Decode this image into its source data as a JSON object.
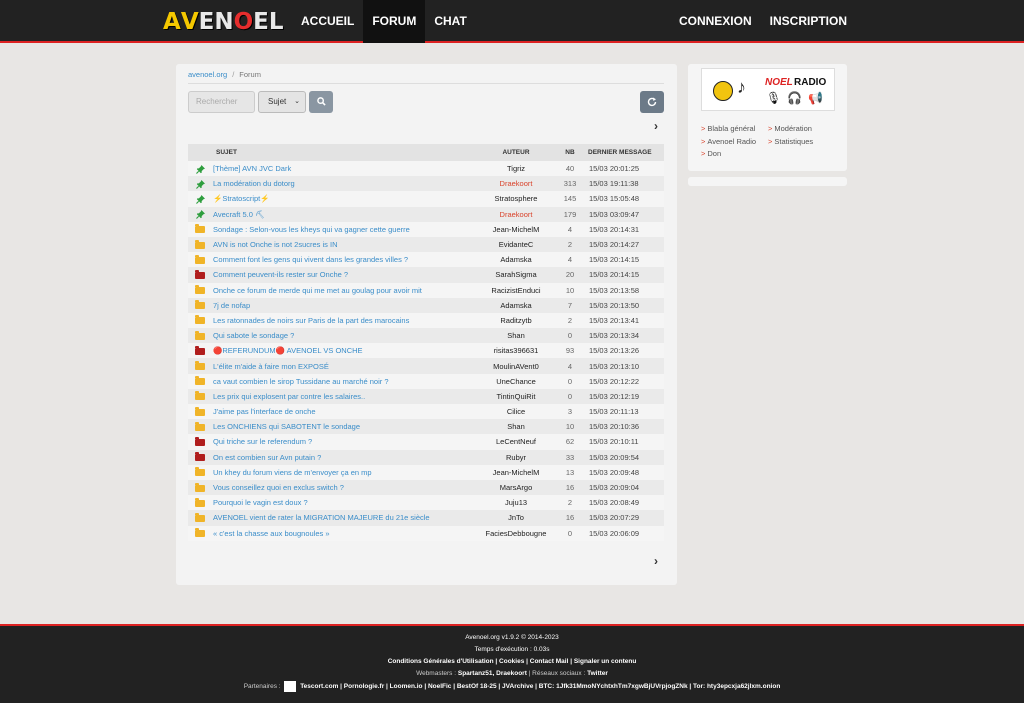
{
  "header": {
    "logo_letters": [
      "A",
      "V",
      "E",
      "N",
      "O",
      "E",
      "L"
    ],
    "logo_colors": [
      "#f5c800",
      "#f5c800",
      "#e8e8e8",
      "#e8e8e8",
      "#e52d2d",
      "#e8e8e8",
      "#e8e8e8"
    ],
    "nav_left": [
      "ACCUEIL",
      "FORUM",
      "CHAT"
    ],
    "nav_right": [
      "CONNEXION",
      "INSCRIPTION"
    ],
    "active": "FORUM"
  },
  "breadcrumb": {
    "home": "avenoel.org",
    "current": "Forum"
  },
  "search": {
    "placeholder": "Rechercher",
    "select_value": "Sujet"
  },
  "table": {
    "headers": {
      "subject": "SUJET",
      "author": "AUTEUR",
      "nb": "NB",
      "last": "DERNIER MESSAGE"
    },
    "rows": [
      {
        "icon": "pin",
        "title": "[Thème] AVN JVC Dark",
        "author": "Tigriz",
        "mod": false,
        "nb": "40",
        "date": "15/03 20:01:25"
      },
      {
        "icon": "pin",
        "title": "La modération du dotorg",
        "author": "Draekoort",
        "mod": true,
        "nb": "313",
        "date": "15/03 19:11:38"
      },
      {
        "icon": "pin",
        "title": "⚡Stratoscript⚡",
        "author": "Stratosphere",
        "mod": false,
        "nb": "145",
        "date": "15/03 15:05:48"
      },
      {
        "icon": "pin",
        "title": "Avecraft 5.0 ⛏",
        "author": "Draekoort",
        "mod": true,
        "nb": "179",
        "date": "15/03 03:09:47"
      },
      {
        "icon": "folder",
        "title": "Sondage : Selon-vous les kheys qui va gagner cette guerre",
        "author": "Jean-MichelM",
        "mod": false,
        "nb": "4",
        "date": "15/03 20:14:31"
      },
      {
        "icon": "folder",
        "title": "AVN is not Onche is not 2sucres is IN",
        "author": "EvidanteC",
        "mod": false,
        "nb": "2",
        "date": "15/03 20:14:27"
      },
      {
        "icon": "folder",
        "title": "Comment font les gens qui vivent dans les grandes villes ?",
        "author": "Adamska",
        "mod": false,
        "nb": "4",
        "date": "15/03 20:14:15"
      },
      {
        "icon": "hot",
        "title": "Comment peuvent-ils rester sur Onche ?",
        "author": "SarahSigma",
        "mod": false,
        "nb": "20",
        "date": "15/03 20:14:15"
      },
      {
        "icon": "folder",
        "title": "Onche ce forum de merde qui me met au goulag pour avoir mit",
        "author": "RacizistEnduci",
        "mod": false,
        "nb": "10",
        "date": "15/03 20:13:58"
      },
      {
        "icon": "folder",
        "title": "7j de nofap",
        "author": "Adamska",
        "mod": false,
        "nb": "7",
        "date": "15/03 20:13:50"
      },
      {
        "icon": "folder",
        "title": "Les ratonnades de noirs sur Paris de la part des marocains",
        "author": "Raditzytb",
        "mod": false,
        "nb": "2",
        "date": "15/03 20:13:41"
      },
      {
        "icon": "folder",
        "title": "Qui sabote le sondage ?",
        "author": "Shan",
        "mod": false,
        "nb": "0",
        "date": "15/03 20:13:34"
      },
      {
        "icon": "hot",
        "title": "🔴REFERUNDUM🔴 AVENOEL VS ONCHE",
        "author": "risitas396631",
        "mod": false,
        "nb": "93",
        "date": "15/03 20:13:26"
      },
      {
        "icon": "folder",
        "title": "L'élite m'aide à faire mon EXPOSÉ",
        "author": "MoulinAVent0",
        "mod": false,
        "nb": "4",
        "date": "15/03 20:13:10"
      },
      {
        "icon": "folder",
        "title": "ca vaut combien le sirop Tussidane au marché noir ?",
        "author": "UneChance",
        "mod": false,
        "nb": "0",
        "date": "15/03 20:12:22"
      },
      {
        "icon": "folder",
        "title": "Les prix qui explosent par contre les salaires..",
        "author": "TintinQuiRit",
        "mod": false,
        "nb": "0",
        "date": "15/03 20:12:19"
      },
      {
        "icon": "folder",
        "title": "J'aime pas l'interface de onche",
        "author": "Cilice",
        "mod": false,
        "nb": "3",
        "date": "15/03 20:11:13"
      },
      {
        "icon": "folder",
        "title": "Les ONCHIENS qui SABOTENT le sondage",
        "author": "Shan",
        "mod": false,
        "nb": "10",
        "date": "15/03 20:10:36"
      },
      {
        "icon": "hot",
        "title": "Qui triche sur le referendum ?",
        "author": "LeCentNeuf",
        "mod": false,
        "nb": "62",
        "date": "15/03 20:10:11"
      },
      {
        "icon": "hot",
        "title": "On est combien sur Avn putain ?",
        "author": "Rubyr",
        "mod": false,
        "nb": "33",
        "date": "15/03 20:09:54"
      },
      {
        "icon": "folder",
        "title": "Un khey du forum viens de m'envoyer ça en mp",
        "author": "Jean-MichelM",
        "mod": false,
        "nb": "13",
        "date": "15/03 20:09:48"
      },
      {
        "icon": "folder",
        "title": "Vous conseillez quoi en exclus switch ?",
        "author": "MarsArgo",
        "mod": false,
        "nb": "16",
        "date": "15/03 20:09:04"
      },
      {
        "icon": "folder",
        "title": "Pourquoi le vagin est doux ?",
        "author": "Juju13",
        "mod": false,
        "nb": "2",
        "date": "15/03 20:08:49"
      },
      {
        "icon": "folder",
        "title": "AVENOEL vient de rater la MIGRATION MAJEURE du 21e siècle",
        "author": "JnTo",
        "mod": false,
        "nb": "16",
        "date": "15/03 20:07:29"
      },
      {
        "icon": "folder",
        "title": "« c'est la chasse aux bougnoules »",
        "author": "FaciesDebbougne",
        "mod": false,
        "nb": "0",
        "date": "15/03 20:06:09"
      }
    ]
  },
  "sidebar": {
    "radio": {
      "noel": "NOEL",
      "radio": "RADIO"
    },
    "links_left": [
      "Blabla général",
      "Avenoel Radio",
      "Don"
    ],
    "links_right": [
      "Modération",
      "Statistiques"
    ]
  },
  "footer": {
    "version": "Avenoel.org v1.9.2 © 2014-2023",
    "exec": "Temps d'exécution : 0.03s",
    "legal": "Conditions Générales d'Utilisation | Cookies | Contact Mail | Signaler un contenu",
    "webmasters_label": "Webmasters :",
    "webmasters": "Spartanz51, Draekoort",
    "social_label": "| Réseaux sociaux :",
    "social": "Twitter",
    "partners_label": "Partenaires :",
    "partners": "Tescort.com | Pornologie.fr | Loomen.io | NoelFic | BestOf 18-25 | JVArchive | BTC: 1Jfk31MmoNYchtxhTm7xgwBjUVrpjogZNk | Tor: hty3epcxja62jlxm.onion"
  },
  "colors": {
    "pin": "#2e9e3e",
    "folder": "#f0b428",
    "hot": "#b01e1e",
    "link": "#3a8dc9",
    "moderator": "#d9432b"
  }
}
